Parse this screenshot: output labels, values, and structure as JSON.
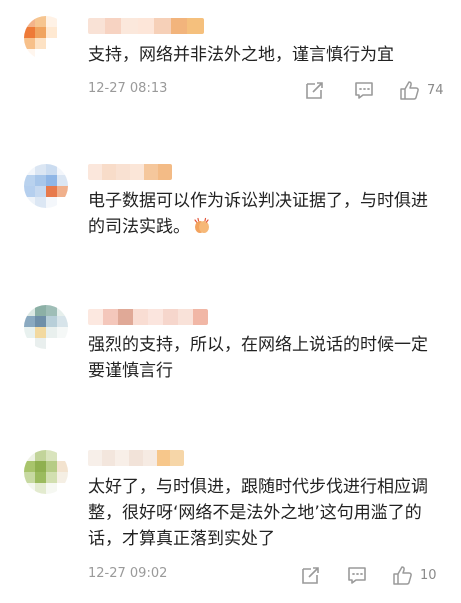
{
  "comments": [
    {
      "text": "支持，网络并非法外之地，谨言慎行为宜",
      "time": "12-27 08:13",
      "likes": "74",
      "avatar_colors": [
        "#f3b38a",
        "#f6c590",
        "#fff2e6",
        "#ffffff",
        "#ee7a37",
        "#f0a460",
        "#ffe9d2",
        "#ffffff",
        "#f7c08a",
        "#fde2c4",
        "#ffffff",
        "#ffffff",
        "#fff6ee",
        "#ffffff",
        "#ffffff",
        "#ffffff"
      ],
      "name_colors": [
        "#f9e2d6",
        "#f7d3c2",
        "#fbe8dc",
        "#fde6d9",
        "#f6d0b8",
        "#f2b47c",
        "#f5c07d"
      ]
    },
    {
      "text": "电子数据可以作为诉讼判决证据了，与时俱进的司法实践。",
      "emoji": "clapping-hands",
      "avatar_colors": [
        "#f2f6fb",
        "#dbe6f3",
        "#cbdcf0",
        "#f3f6fb",
        "#b9d2ee",
        "#a7c6ea",
        "#8fb6e6",
        "#dbe6f3",
        "#b5cfee",
        "#c6d9f0",
        "#e77a4c",
        "#f0b08c",
        "#eef3f9",
        "#dce7f4",
        "#f4f7fb",
        "#ffffff"
      ],
      "name_colors": [
        "#fbe7dc",
        "#f8dcc9",
        "#f9e1d2",
        "#fbe6d8",
        "#f5c79c",
        "#f3bb86"
      ]
    },
    {
      "text": "强烈的支持，所以，在网络上说话的时候一定要谨慎言行",
      "avatar_colors": [
        "#dde9e4",
        "#8cb0a6",
        "#9fbeb7",
        "#e6efec",
        "#8aa9c0",
        "#6f8fa8",
        "#b8cfd9",
        "#d7e4ea",
        "#e8f1ef",
        "#f2d9a0",
        "#e9f0ee",
        "#f5f8f7",
        "#ffffff",
        "#e9efee",
        "#ffffff",
        "#ffffff"
      ],
      "name_colors": [
        "#fce8e0",
        "#f4c7bb",
        "#e0a997",
        "#f9ddd3",
        "#fbe5de",
        "#f6d6cc",
        "#f9e2d9",
        "#f1b7a6"
      ]
    },
    {
      "text": "太好了，与时俱进，跟随时代步伐进行相应调整，很好呀‘网络不是法外之地’这句用滥了的话，才算真正落到实处了",
      "time": "12-27 09:02",
      "likes": "10",
      "avatar_colors": [
        "#eef2e4",
        "#c2d49a",
        "#d9e4bd",
        "#ffffff",
        "#a8c46c",
        "#8fb04f",
        "#b6cc85",
        "#f3e3cf",
        "#c7d9a1",
        "#9bbb5e",
        "#d2dfb0",
        "#f5efe4",
        "#f4f7ee",
        "#e3ebcf",
        "#f6f8f2",
        "#ffffff"
      ],
      "name_colors": [
        "#f7efe9",
        "#f3e6dd",
        "#f8efe8",
        "#f2e3d9",
        "#f6ebe3",
        "#f7c78b",
        "#f6d6a8"
      ]
    }
  ],
  "icons": [
    "share-icon",
    "comment-icon",
    "thumbs-up-icon"
  ],
  "colors": {
    "icon": "#9a9a9a",
    "meta_text": "#9a9a9a",
    "text": "#222222"
  }
}
